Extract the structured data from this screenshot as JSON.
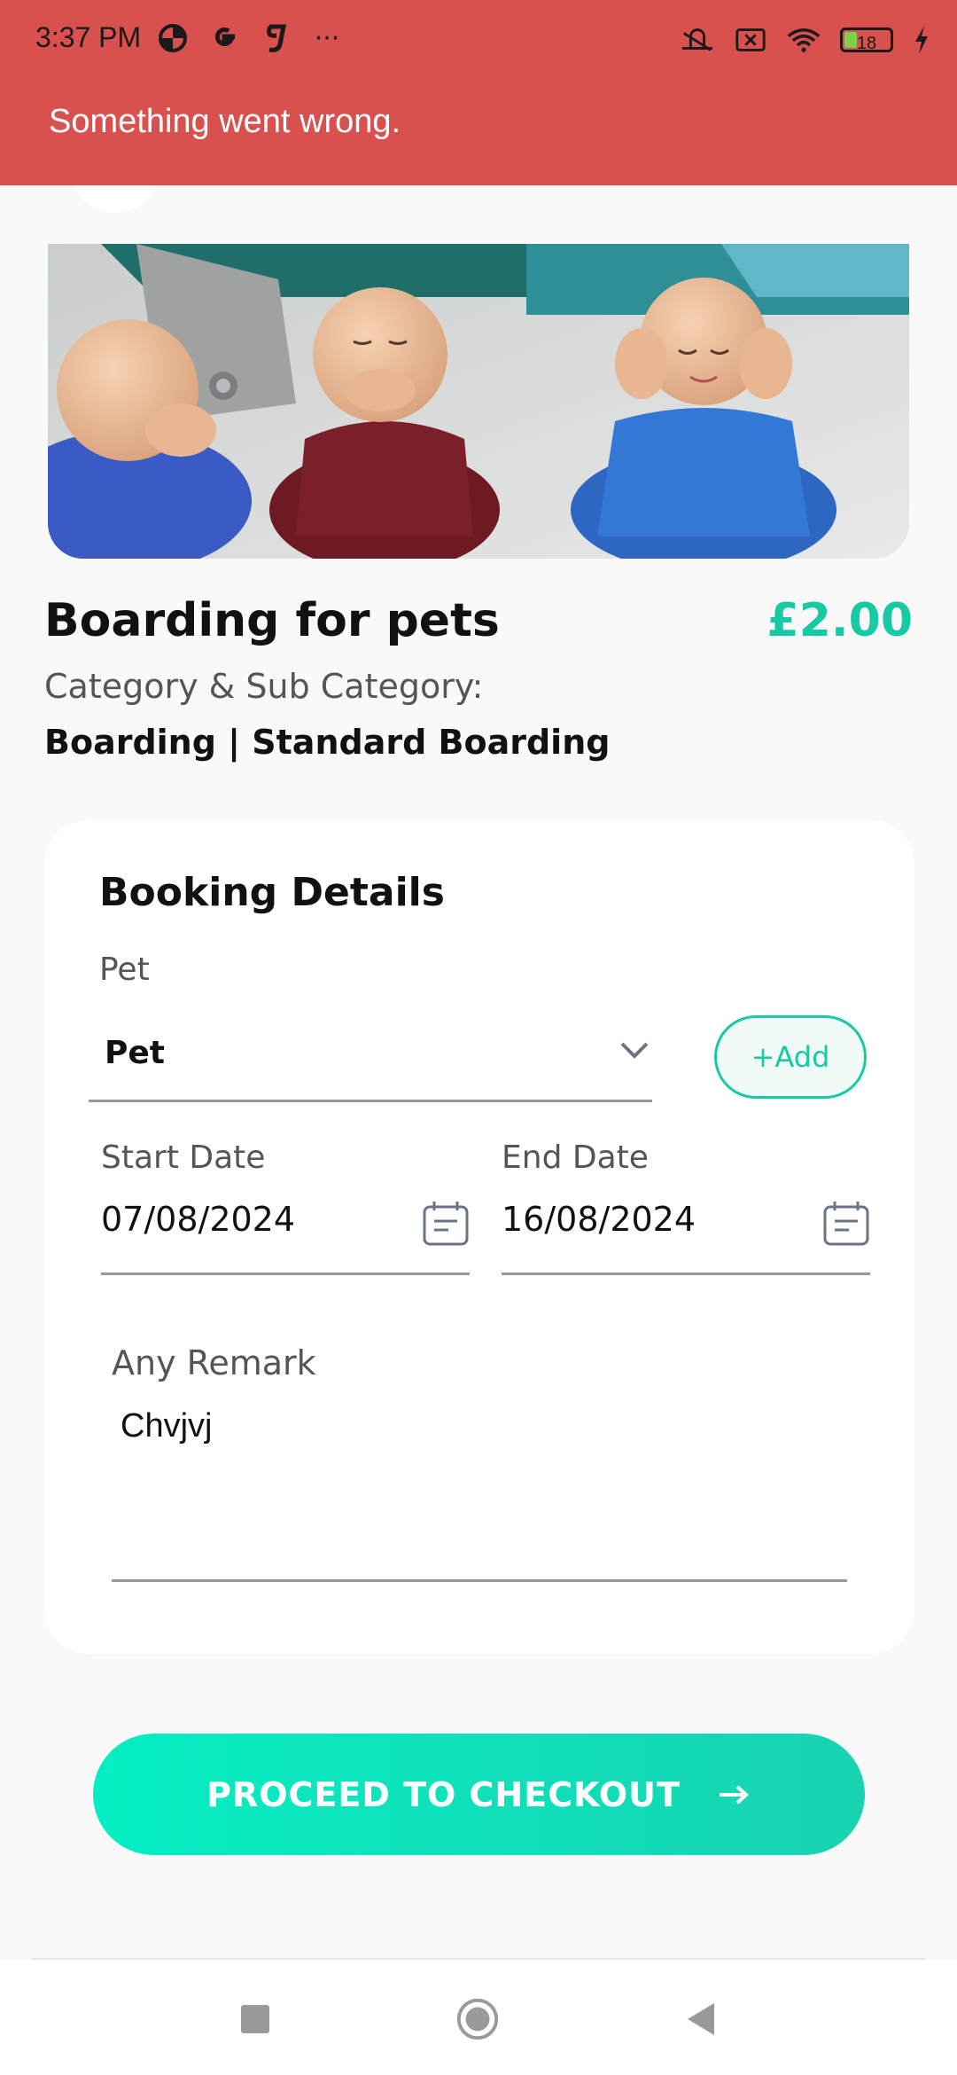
{
  "status_bar": {
    "time": "3:37 PM",
    "overflow": "···",
    "battery_level": "18",
    "icons": [
      "pie-icon",
      "google-icon",
      "g-icon",
      "mute-icon",
      "sim-off-icon",
      "wifi-icon",
      "battery-icon",
      "charging-icon"
    ]
  },
  "error": {
    "message": "Something went wrong."
  },
  "service": {
    "title": "Boarding for pets",
    "price": "£2.00",
    "category_label": "Category & Sub Category:",
    "category_value": "Boarding | Standard Boarding"
  },
  "booking": {
    "title": "Booking Details",
    "pet_label": "Pet",
    "pet_value": "Pet",
    "add_label": "+Add",
    "start_label": "Start Date",
    "start_value": "07/08/2024",
    "end_label": "End Date",
    "end_value": "16/08/2024",
    "remark_label": "Any Remark",
    "remark_value": "Chvjvj"
  },
  "checkout": {
    "label": "PROCEED TO CHECKOUT"
  },
  "colors": {
    "error": "#d9514f",
    "accent": "#18c9a5",
    "button_start": "#05eec3",
    "button_end": "#18d3b1"
  },
  "nav": {
    "icons": [
      "recents-icon",
      "home-icon",
      "back-icon"
    ]
  }
}
